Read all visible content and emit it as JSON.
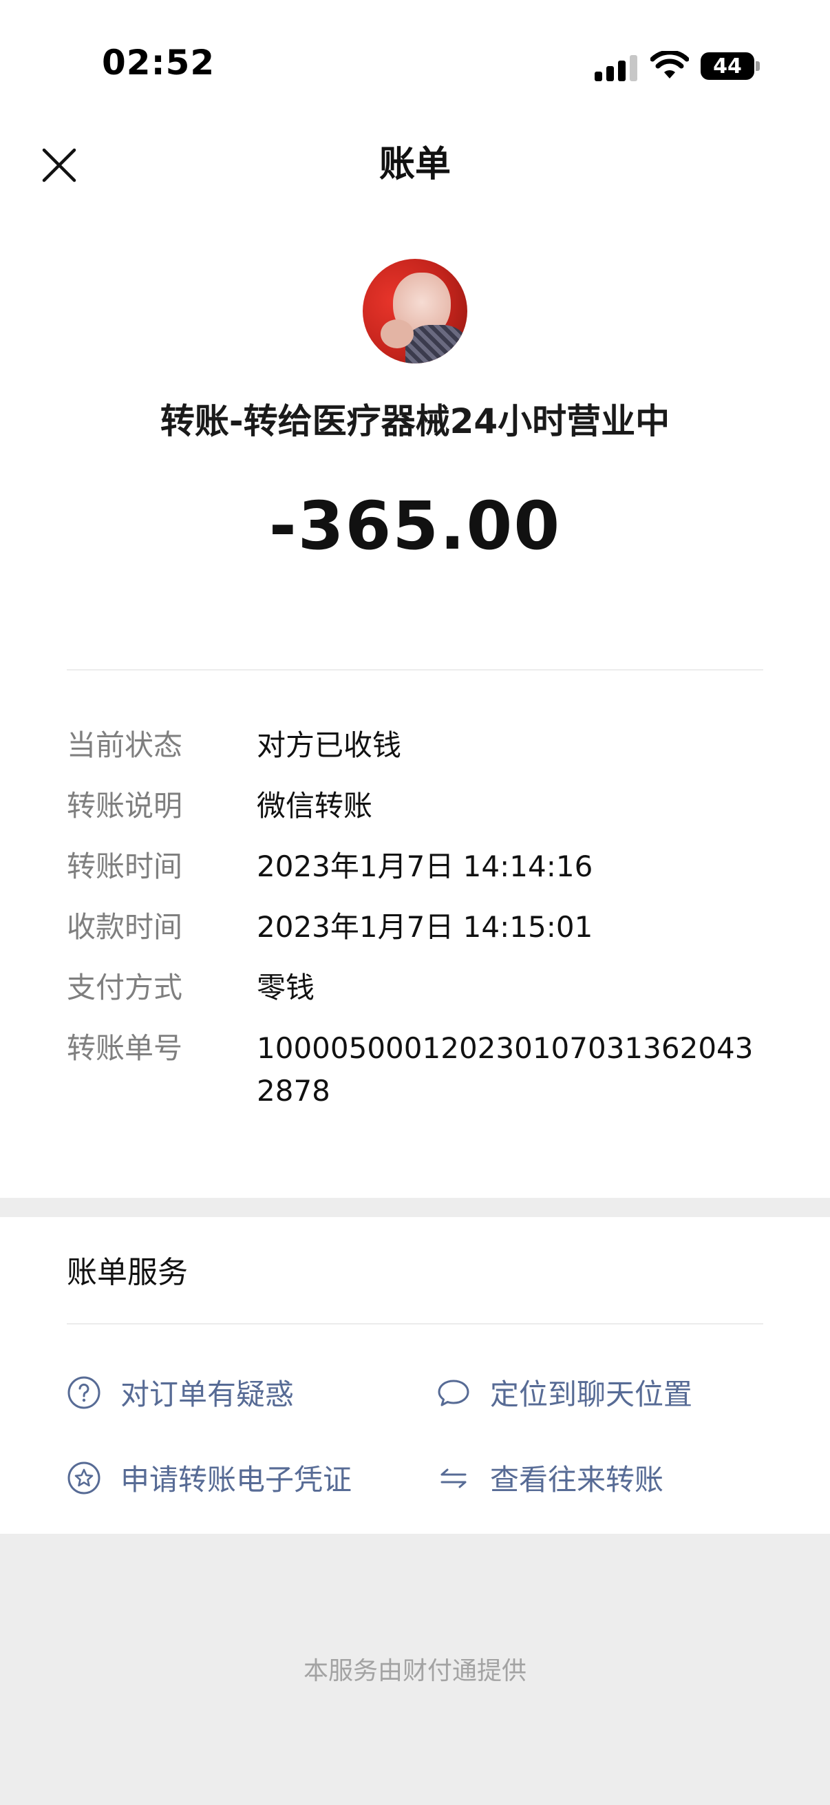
{
  "status_bar": {
    "time": "02:52",
    "battery": "44"
  },
  "nav": {
    "title": "账单"
  },
  "transaction": {
    "payee": "转账-转给医疗器械24小时营业中",
    "amount": "-365.00"
  },
  "details": [
    {
      "label": "当前状态",
      "value": "对方已收钱"
    },
    {
      "label": "转账说明",
      "value": "微信转账"
    },
    {
      "label": "转账时间",
      "value": "2023年1月7日 14:14:16"
    },
    {
      "label": "收款时间",
      "value": "2023年1月7日 14:15:01"
    },
    {
      "label": "支付方式",
      "value": "零钱"
    },
    {
      "label": "转账单号",
      "value": "100005000120230107031362043 2878"
    }
  ],
  "services": {
    "title": "账单服务",
    "items": [
      {
        "label": "对订单有疑惑",
        "icon": "question-circle-icon"
      },
      {
        "label": "定位到聊天位置",
        "icon": "chat-bubble-icon"
      },
      {
        "label": "申请转账电子凭证",
        "icon": "star-badge-icon"
      },
      {
        "label": "查看往来转账",
        "icon": "swap-arrows-icon"
      }
    ]
  },
  "footer": {
    "text": "本服务由财付通提供"
  },
  "colors": {
    "link": "#576b95",
    "label_gray": "#7f7f7f",
    "band_gray": "#ededed"
  }
}
